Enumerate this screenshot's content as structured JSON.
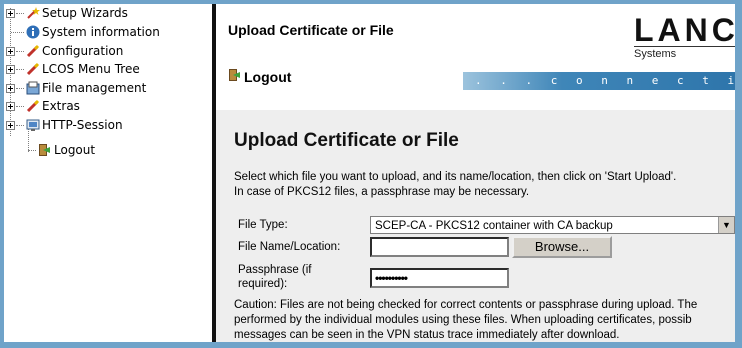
{
  "tree": {
    "items": [
      {
        "label": "Setup Wizards",
        "icon": "wand-icon"
      },
      {
        "label": "System information",
        "icon": "info-icon"
      },
      {
        "label": "Configuration",
        "icon": "wand-icon"
      },
      {
        "label": "LCOS Menu Tree",
        "icon": "wand-icon"
      },
      {
        "label": "File management",
        "icon": "file-management-icon"
      },
      {
        "label": "Extras",
        "icon": "wand-icon"
      },
      {
        "label": "HTTP-Session",
        "icon": "monitor-icon"
      },
      {
        "label": "Logout",
        "icon": "logout-icon"
      }
    ]
  },
  "header": {
    "title": "Upload Certificate or File",
    "logo": "LANC",
    "logo_sub": "Systems",
    "logout": "Logout",
    "tagline": ". . .  c o n n e c t i n g   y o u r   b"
  },
  "main": {
    "heading": "Upload Certificate or File",
    "desc_line1": "Select which file you want to upload, and its name/location, then click on 'Start Upload'.",
    "desc_line2": "In case of PKCS12 files, a passphrase may be necessary.",
    "file_type_label": "File Type:",
    "file_type_value": "SCEP-CA - PKCS12 container with CA backup",
    "file_name_label": "File Name/Location:",
    "browse_label": "Browse...",
    "passphrase_label_1": "Passphrase (if",
    "passphrase_label_2": "required):",
    "passphrase_value": "••••••••••",
    "caution_line1": "Caution: Files are not being checked for correct contents or passphrase during upload. The",
    "caution_line2": "performed by the individual modules using these files. When uploading certificates, possib",
    "caution_line3": "messages can be seen in the VPN status trace immediately after download."
  },
  "colors": {
    "frame": "#6fa3c9",
    "content_bg": "#eeeeee",
    "tagline_bar": "#2d74aa"
  }
}
